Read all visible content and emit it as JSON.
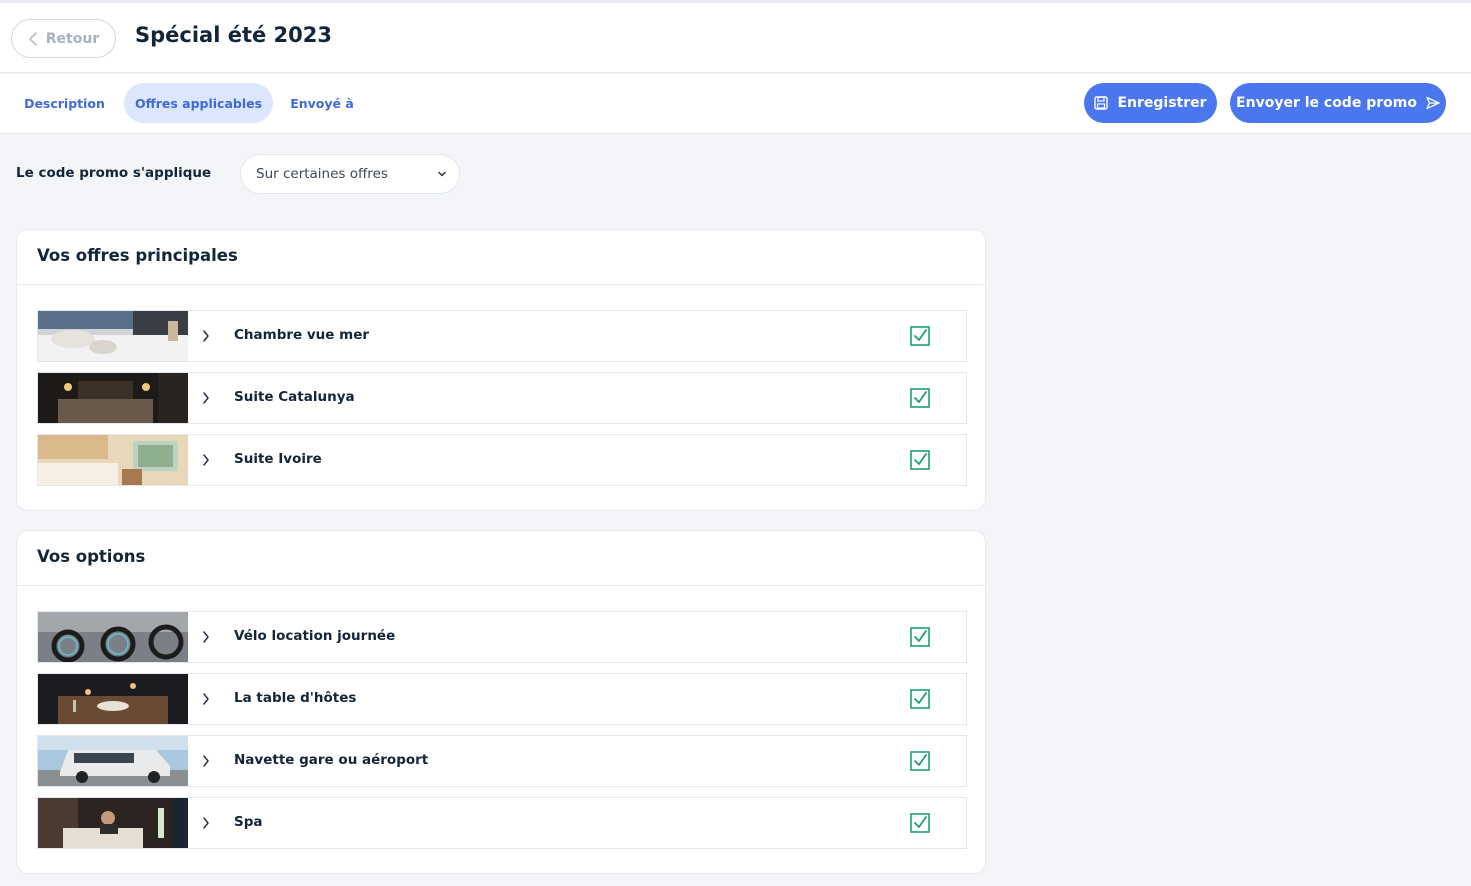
{
  "header": {
    "back_label": "Retour",
    "title": "Spécial été 2023"
  },
  "tabs": [
    {
      "label": "Description",
      "active": false
    },
    {
      "label": "Offres applicables",
      "active": true
    },
    {
      "label": "Envoyé à",
      "active": false
    }
  ],
  "actions": {
    "save_label": "Enregistrer",
    "send_label": "Envoyer le code promo"
  },
  "promo": {
    "label": "Le code promo s'applique",
    "selected": "Sur certaines offres"
  },
  "main_offers": {
    "title": "Vos offres principales",
    "items": [
      {
        "name": "Chambre vue mer",
        "thumb": "bedroom-photo",
        "checked": true
      },
      {
        "name": "Suite Catalunya",
        "thumb": "dark-suite-photo",
        "checked": true
      },
      {
        "name": "Suite Ivoire",
        "thumb": "ivory-suite-photo",
        "checked": true
      }
    ]
  },
  "options": {
    "title": "Vos options",
    "items": [
      {
        "name": "Vélo location journée",
        "thumb": "bicycles-photo",
        "checked": true
      },
      {
        "name": "La table d'hôtes",
        "thumb": "dining-table-photo",
        "checked": true
      },
      {
        "name": "Navette gare ou aéroport",
        "thumb": "shuttle-van-photo",
        "checked": true
      },
      {
        "name": "Spa",
        "thumb": "spa-photo",
        "checked": true
      }
    ]
  },
  "colors": {
    "accent": "#4a76ee",
    "tab_text": "#3f6ad8",
    "tab_active_bg": "#dce6fd",
    "check": "#1f9e7a",
    "background": "#f3f5f9"
  }
}
